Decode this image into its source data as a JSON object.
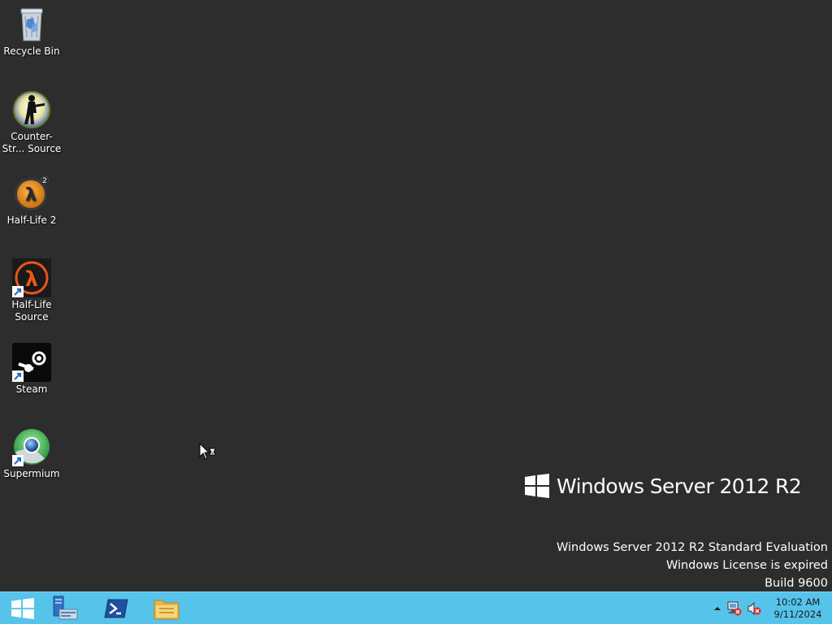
{
  "desktop": {
    "background": "#2d2d2d",
    "icons": [
      {
        "label": "Recycle Bin",
        "icon": "recycle-bin-icon",
        "shortcut": false
      },
      {
        "label": "Counter-Str... Source",
        "icon": "counter-strike-source-icon",
        "shortcut": false
      },
      {
        "label": "Half-Life 2",
        "icon": "half-life-2-icon",
        "shortcut": false
      },
      {
        "label": "Half-Life Source",
        "icon": "half-life-source-icon",
        "shortcut": true
      },
      {
        "label": "Steam",
        "icon": "steam-icon",
        "shortcut": true
      },
      {
        "label": "Supermium",
        "icon": "supermium-icon",
        "shortcut": true
      }
    ]
  },
  "branding": {
    "product_name": "Windows Server 2012 R2"
  },
  "watermark": {
    "line1": "Windows Server 2012 R2 Standard Evaluation",
    "line2": "Windows License is expired",
    "line3": "Build 9600"
  },
  "taskbar": {
    "color": "#56c3ea",
    "pinned": [
      {
        "name": "start-button",
        "icon": "windows-logo-icon"
      },
      {
        "name": "server-manager-button",
        "icon": "server-manager-icon"
      },
      {
        "name": "powershell-button",
        "icon": "powershell-icon"
      },
      {
        "name": "file-explorer-button",
        "icon": "folder-icon"
      }
    ],
    "tray": {
      "icons": [
        "show-hidden-icons-chevron",
        "network-error-icon",
        "volume-muted-icon"
      ],
      "time": "10:02 AM",
      "date": "9/11/2024"
    }
  }
}
